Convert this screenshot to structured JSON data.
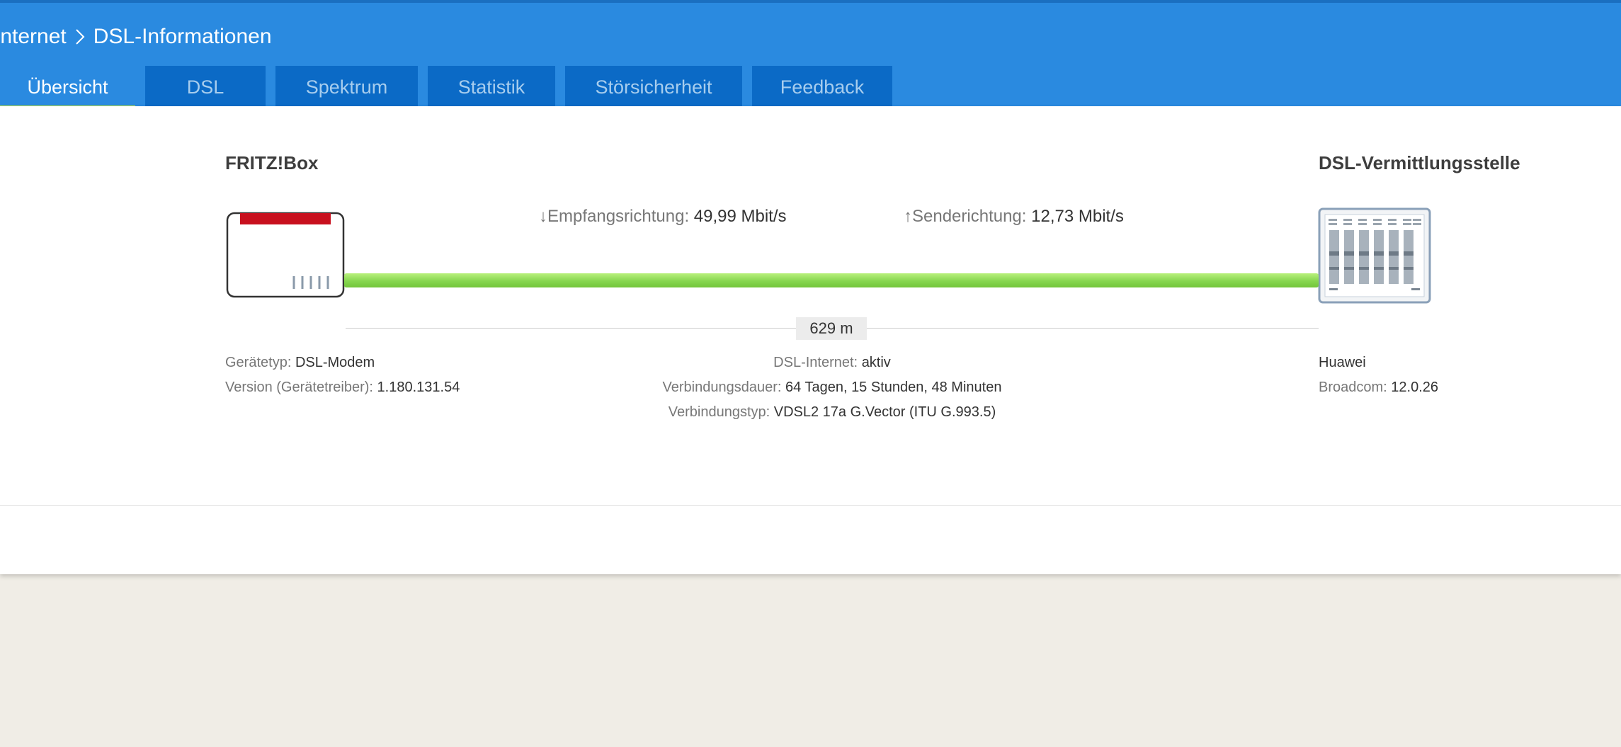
{
  "breadcrumb": {
    "parent": "Internet",
    "current": "DSL-Informationen"
  },
  "tabs": [
    {
      "label": "Übersicht",
      "active": true
    },
    {
      "label": "DSL",
      "active": false
    },
    {
      "label": "Spektrum",
      "active": false
    },
    {
      "label": "Statistik",
      "active": false
    },
    {
      "label": "Störsicherheit",
      "active": false
    },
    {
      "label": "Feedback",
      "active": false
    }
  ],
  "overview": {
    "left_device": "FRITZ!Box",
    "right_device": "DSL-Vermittlungsstelle",
    "downstream_label": "↓Empfangsrichtung:",
    "downstream_value": "49,99 Mbit/s",
    "upstream_label": "↑Senderichtung:",
    "upstream_value": "12,73 Mbit/s",
    "distance": "629 m",
    "line_color": "#86d64f",
    "box_accent_color": "#c8101e",
    "left_info": {
      "device_type_label": "Gerätetyp:",
      "device_type_value": "DSL-Modem",
      "version_label": "Version (Gerätetreiber):",
      "version_value": "1.180.131.54"
    },
    "center_info": {
      "internet_label": "DSL-Internet:",
      "internet_value": "aktiv",
      "duration_label": "Verbindungsdauer:",
      "duration_value": "64 Tagen, 15 Stunden, 48 Minuten",
      "type_label": "Verbindungstyp:",
      "type_value": "VDSL2 17a G.Vector (ITU G.993.5)"
    },
    "right_info": {
      "vendor": "Huawei",
      "chip_label": "Broadcom:",
      "chip_value": "12.0.26"
    }
  },
  "colors": {
    "header": "#2a8ae0",
    "tab_inactive": "#0b6ac6",
    "tab_active_underline": "#c8e83a"
  }
}
